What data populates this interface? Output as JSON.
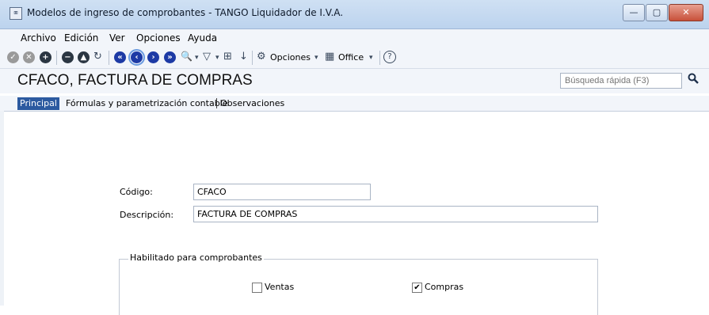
{
  "window": {
    "icon_glyph": "⌧",
    "title": "Modelos de ingreso de comprobantes - TANGO Liquidador de I.V.A.",
    "controls": {
      "minimize": "—",
      "maximize": "▢",
      "close": "✕"
    }
  },
  "menu": [
    {
      "label": "Archivo"
    },
    {
      "label": "Edición"
    },
    {
      "label": "Ver"
    },
    {
      "label": "Opciones"
    },
    {
      "label": "Ayuda"
    }
  ],
  "toolbar": {
    "options_label": "Opciones",
    "office_label": "Office",
    "icons": {
      "accept": "✓",
      "cancel": "✕",
      "add": "+",
      "delete": "−",
      "edit": "▲",
      "refresh": "↻",
      "first": "«",
      "prev": "‹",
      "next": "›",
      "last": "»",
      "binoculars": "🔍",
      "filter": "▽",
      "grid": "⊞",
      "sort": "↓",
      "gear": "⚙",
      "office": "▦",
      "help": "?",
      "dropdown": "▾"
    }
  },
  "header": {
    "title": "CFACO, FACTURA DE  COMPRAS",
    "search_placeholder": "Búsqueda rápida (F3)"
  },
  "tabs": [
    {
      "label": "Principal",
      "active": true
    },
    {
      "label": "Fórmulas y parametrización contable",
      "active": false
    },
    {
      "label": "Observaciones",
      "active": false
    }
  ],
  "form": {
    "codigo_label": "Código:",
    "codigo_value": "CFACO",
    "descripcion_label": "Descripción:",
    "descripcion_value": "FACTURA DE  COMPRAS",
    "group_title": "Habilitado para comprobantes",
    "ventas_label": "Ventas",
    "ventas_checked": false,
    "compras_label": "Compras",
    "compras_checked": true,
    "check_mark": "✔"
  }
}
